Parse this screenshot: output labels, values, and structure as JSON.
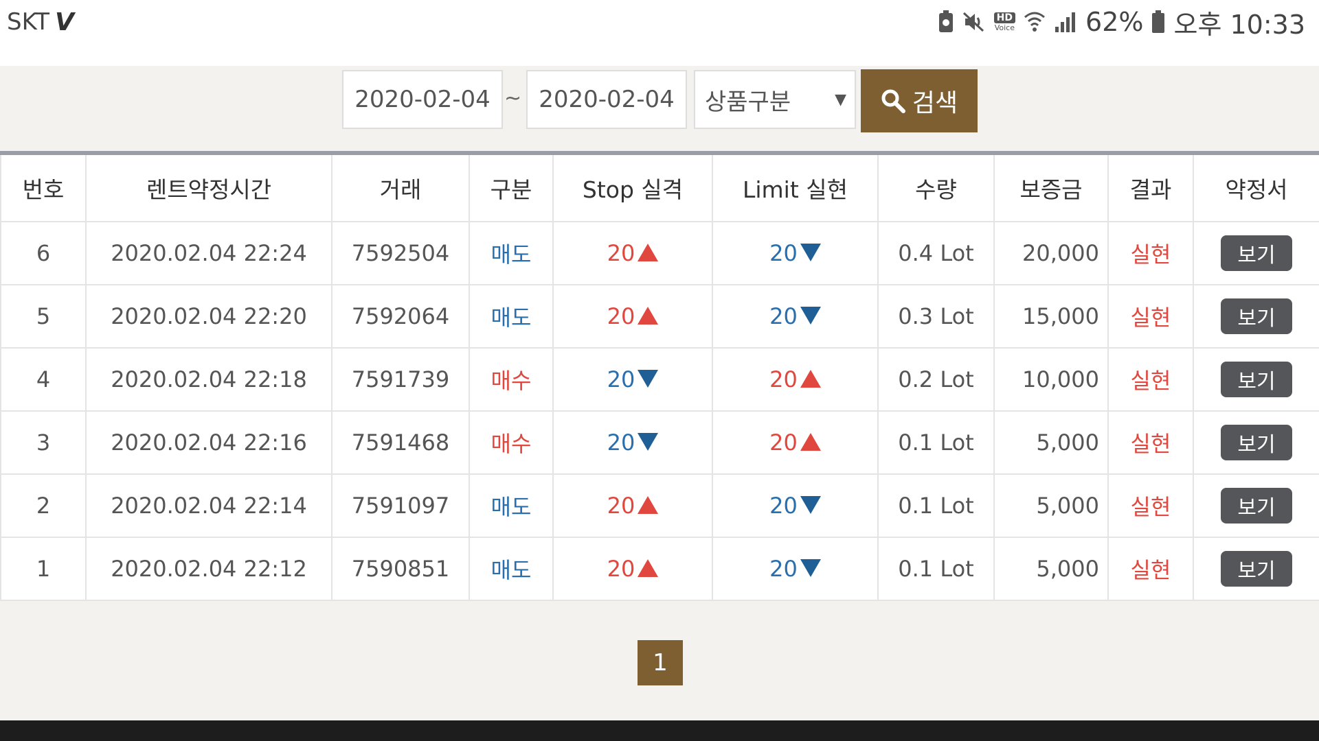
{
  "status_bar": {
    "carrier": "SKT",
    "carrier_logo": "V",
    "battery_percent": "62%",
    "time": "오후 10:33",
    "icons": [
      "nfc-icon",
      "mute-icon",
      "hd-voice-icon",
      "wifi-icon",
      "signal-icon",
      "battery-icon"
    ],
    "hd_label": "HD",
    "voice_label": "Voice"
  },
  "search": {
    "date_from": "2020-02-04",
    "separator": "~",
    "date_to": "2020-02-04",
    "product_select": "상품구분",
    "button_label": "검색"
  },
  "table": {
    "headers": [
      "번호",
      "렌트약정시간",
      "거래",
      "구분",
      "Stop 실격",
      "Limit 실현",
      "수량",
      "보증금",
      "결과",
      "약정서"
    ],
    "rows": [
      {
        "no": "6",
        "time": "2020.02.04 22:24",
        "trade": "7592504",
        "type": "매도",
        "type_kind": "sell",
        "stop": "20",
        "stop_dir": "up",
        "limit": "20",
        "limit_dir": "down",
        "qty": "0.4 Lot",
        "deposit": "20,000",
        "result": "실현",
        "view": "보기"
      },
      {
        "no": "5",
        "time": "2020.02.04 22:20",
        "trade": "7592064",
        "type": "매도",
        "type_kind": "sell",
        "stop": "20",
        "stop_dir": "up",
        "limit": "20",
        "limit_dir": "down",
        "qty": "0.3 Lot",
        "deposit": "15,000",
        "result": "실현",
        "view": "보기"
      },
      {
        "no": "4",
        "time": "2020.02.04 22:18",
        "trade": "7591739",
        "type": "매수",
        "type_kind": "buy",
        "stop": "20",
        "stop_dir": "down",
        "limit": "20",
        "limit_dir": "up",
        "qty": "0.2 Lot",
        "deposit": "10,000",
        "result": "실현",
        "view": "보기"
      },
      {
        "no": "3",
        "time": "2020.02.04 22:16",
        "trade": "7591468",
        "type": "매수",
        "type_kind": "buy",
        "stop": "20",
        "stop_dir": "down",
        "limit": "20",
        "limit_dir": "up",
        "qty": "0.1 Lot",
        "deposit": "5,000",
        "result": "실현",
        "view": "보기"
      },
      {
        "no": "2",
        "time": "2020.02.04 22:14",
        "trade": "7591097",
        "type": "매도",
        "type_kind": "sell",
        "stop": "20",
        "stop_dir": "up",
        "limit": "20",
        "limit_dir": "down",
        "qty": "0.1 Lot",
        "deposit": "5,000",
        "result": "실현",
        "view": "보기"
      },
      {
        "no": "1",
        "time": "2020.02.04 22:12",
        "trade": "7590851",
        "type": "매도",
        "type_kind": "sell",
        "stop": "20",
        "stop_dir": "up",
        "limit": "20",
        "limit_dir": "down",
        "qty": "0.1 Lot",
        "deposit": "5,000",
        "result": "실현",
        "view": "보기"
      }
    ]
  },
  "pagination": {
    "current_page": "1"
  },
  "colors": {
    "accent": "#7e5f31",
    "sell": "#2a6fad",
    "buy": "#e0483f",
    "view_button": "#555659"
  }
}
